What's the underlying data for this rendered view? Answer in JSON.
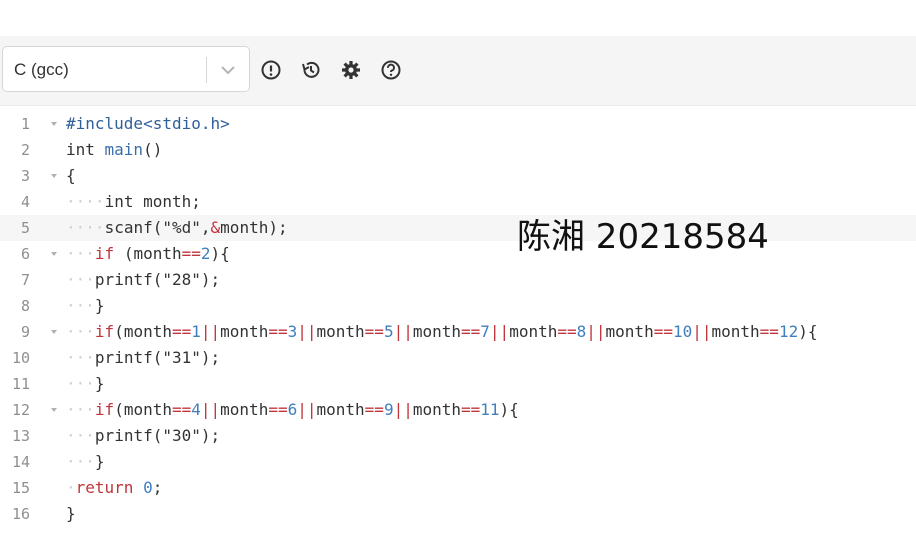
{
  "toolbar": {
    "language": "C (gcc)",
    "icons": [
      "alert-circle-icon",
      "history-icon",
      "gear-icon",
      "help-circle-icon"
    ]
  },
  "editor": {
    "line_numbers": [
      "1",
      "2",
      "3",
      "4",
      "5",
      "6",
      "7",
      "8",
      "9",
      "10",
      "11",
      "12",
      "13",
      "14",
      "15",
      "16"
    ],
    "lines": [
      "#include<stdio.h>",
      "int main()",
      "{",
      "    int month;",
      "    scanf(\"%d\",&month);",
      "   if (month==2){",
      "   printf(\"28\");",
      "   }",
      "   if(month==1||month==3||month==5||month==7||month==8||month==10||month==12){",
      "   printf(\"31\");",
      "   }",
      "   if(month==4||month==6||month==9||month==11){",
      "   printf(\"30\");",
      "   }",
      " return 0;",
      "}"
    ],
    "active_line": 5
  },
  "watermark": "陈湘 20218584",
  "colors": {
    "keyword": "#c0343b",
    "number": "#3f7fbf",
    "function": "#3b6ea8",
    "toolbar_bg": "#f5f5f6"
  }
}
